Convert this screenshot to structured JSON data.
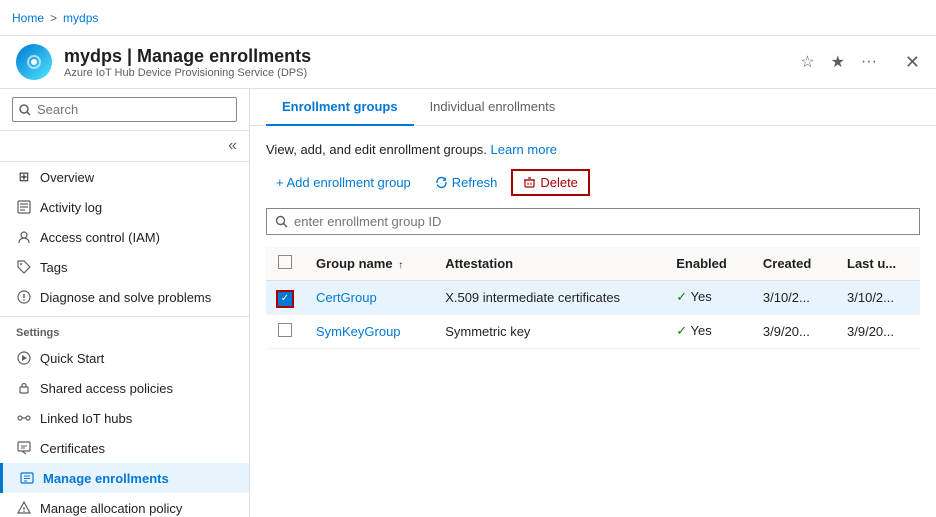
{
  "breadcrumb": {
    "home": "Home",
    "separator": ">",
    "current": "mydps"
  },
  "header": {
    "title": "mydps | Manage enrollments",
    "subtitle": "Azure IoT Hub Device Provisioning Service (DPS)",
    "icon_char": "⚙"
  },
  "header_actions": {
    "favorite_icon": "★",
    "pin_icon": "📌",
    "more_icon": "...",
    "close_icon": "✕"
  },
  "sidebar": {
    "search_placeholder": "Search",
    "nav_items": [
      {
        "id": "overview",
        "label": "Overview",
        "icon": "⊞"
      },
      {
        "id": "activity-log",
        "label": "Activity log",
        "icon": "📋"
      },
      {
        "id": "access-control",
        "label": "Access control (IAM)",
        "icon": "🔒"
      },
      {
        "id": "tags",
        "label": "Tags",
        "icon": "🏷"
      },
      {
        "id": "diagnose",
        "label": "Diagnose and solve problems",
        "icon": "🔧"
      }
    ],
    "settings_label": "Settings",
    "settings_items": [
      {
        "id": "quick-start",
        "label": "Quick Start",
        "icon": "☁"
      },
      {
        "id": "shared-access",
        "label": "Shared access policies",
        "icon": "🔑"
      },
      {
        "id": "linked-iot",
        "label": "Linked IoT hubs",
        "icon": "🔗"
      },
      {
        "id": "certificates",
        "label": "Certificates",
        "icon": "📄"
      },
      {
        "id": "manage-enrollments",
        "label": "Manage enrollments",
        "icon": "🗒",
        "active": true
      },
      {
        "id": "manage-allocation",
        "label": "Manage allocation policy",
        "icon": "⚡"
      }
    ]
  },
  "content": {
    "tabs": [
      {
        "id": "enrollment-groups",
        "label": "Enrollment groups",
        "active": true
      },
      {
        "id": "individual-enrollments",
        "label": "Individual enrollments",
        "active": false
      }
    ],
    "description": "View, add, and edit enrollment groups.",
    "learn_more": "Learn more",
    "toolbar": {
      "add_label": "+ Add enrollment group",
      "refresh_label": "Refresh",
      "delete_label": "Delete"
    },
    "search_placeholder": "enter enrollment group ID",
    "table": {
      "columns": [
        {
          "id": "group-name",
          "label": "Group name",
          "sortable": true
        },
        {
          "id": "attestation",
          "label": "Attestation"
        },
        {
          "id": "enabled",
          "label": "Enabled"
        },
        {
          "id": "created",
          "label": "Created"
        },
        {
          "id": "last-updated",
          "label": "Last u..."
        }
      ],
      "rows": [
        {
          "id": "certgroup",
          "group_name": "CertGroup",
          "attestation": "X.509 intermediate certificates",
          "enabled": "Yes",
          "created": "3/10/2...",
          "last_updated": "3/10/2...",
          "selected": true
        },
        {
          "id": "symkeygroup",
          "group_name": "SymKeyGroup",
          "attestation": "Symmetric key",
          "enabled": "Yes",
          "created": "3/9/20...",
          "last_updated": "3/9/20...",
          "selected": false
        }
      ]
    }
  }
}
